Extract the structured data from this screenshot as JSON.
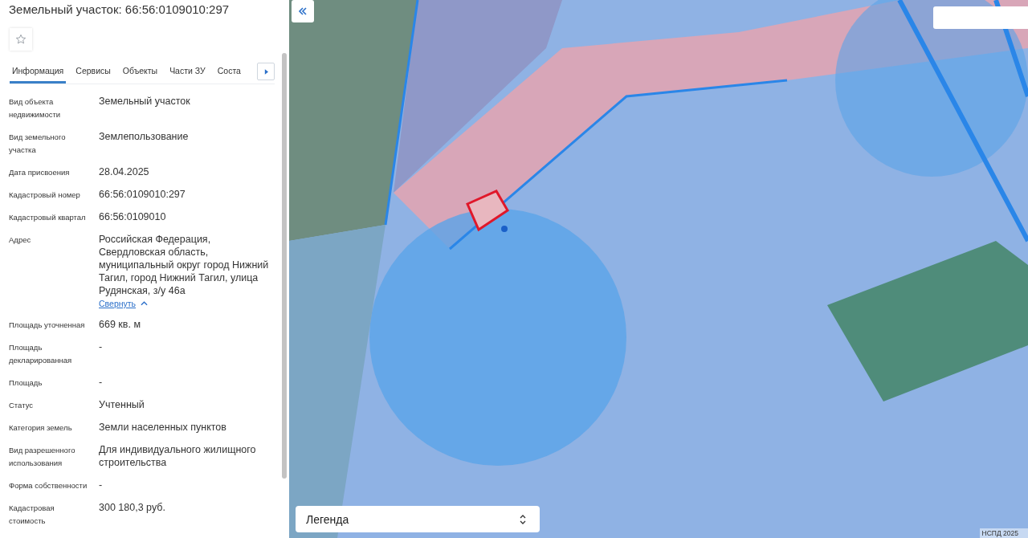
{
  "panel": {
    "title": "Земельный участок: 66:56:0109010:297",
    "favorite": {
      "on": false
    },
    "tabs": [
      {
        "label": "Информация",
        "selected": true
      },
      {
        "label": "Сервисы",
        "selected": false
      },
      {
        "label": "Объекты",
        "selected": false
      },
      {
        "label": "Части ЗУ",
        "selected": false
      },
      {
        "label": "Соста",
        "selected": false
      }
    ],
    "fields": [
      {
        "label": "Вид объекта недвижимости",
        "value": "Земельный участок"
      },
      {
        "label": "Вид земельного участка",
        "value": "Землепользование"
      },
      {
        "label": "Дата присвоения",
        "value": "28.04.2025"
      },
      {
        "label": "Кадастровый номер",
        "value": "66:56:0109010:297"
      },
      {
        "label": "Кадастровый квартал",
        "value": "66:56:0109010"
      },
      {
        "label": "Адрес",
        "value": "Российская Федерация, Свердловская область, муниципальный округ город Нижний Тагил, город Нижний Тагил, улица Рудянская, з/у 46а",
        "link": "Свернуть"
      },
      {
        "label": "Площадь уточненная",
        "value": "669 кв. м"
      },
      {
        "label": "Площадь декларированная",
        "value": "-"
      },
      {
        "label": "Площадь",
        "value": "-"
      },
      {
        "label": "Статус",
        "value": "Учтенный"
      },
      {
        "label": "Категория земель",
        "value": "Земли населенных пунктов"
      },
      {
        "label": "Вид разрешенного использования",
        "value": "Для индивидуального жилищного строительства"
      },
      {
        "label": "Форма собственности",
        "value": "-"
      },
      {
        "label": "Кадастровая стоимость",
        "value": "300 180,3 руб."
      }
    ]
  },
  "map": {
    "legend": {
      "label": "Легенда"
    },
    "attribution": "НСПД 2025"
  }
}
